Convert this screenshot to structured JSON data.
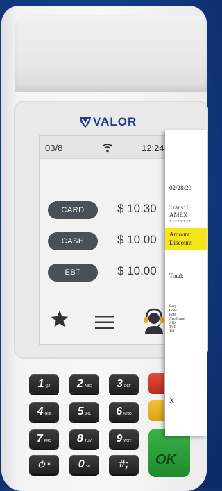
{
  "brand": {
    "name": "VALOR"
  },
  "status_bar": {
    "date": "03/8",
    "time": "12:24"
  },
  "payments": [
    {
      "label": "CARD",
      "amount": "$ 10.30"
    },
    {
      "label": "CASH",
      "amount": "$ 10.00"
    },
    {
      "label": "EBT",
      "amount": "$ 10.00"
    }
  ],
  "nav_icons": [
    "star-icon",
    "menu-icon",
    "support-agent-icon"
  ],
  "keypad": [
    {
      "num": "1",
      "sub": "QZ"
    },
    {
      "num": "2",
      "sub": "ABC"
    },
    {
      "num": "3",
      "sub": "DEF"
    },
    {
      "num": "4",
      "sub": "GHI"
    },
    {
      "num": "5",
      "sub": "JKL"
    },
    {
      "num": "6",
      "sub": "MNO"
    },
    {
      "num": "7",
      "sub": "PRS"
    },
    {
      "num": "8",
      "sub": "TUV"
    },
    {
      "num": "9",
      "sub": "WXY"
    },
    {
      "num": "⏻ *",
      "sub": ""
    },
    {
      "num": "0",
      "sub": "SP"
    },
    {
      "num": "#;",
      "sub": ""
    }
  ],
  "function_keys": {
    "ok_label": "OK"
  },
  "receipt": {
    "date": "02/28/20",
    "trans": "Trans: 6",
    "card": "AMEX",
    "masked": "********",
    "amount_label": "Amount:",
    "discount_label": "Discount",
    "total_label": "Total:",
    "details": [
      "Resp",
      "Code",
      "Ref#",
      "App Name",
      "AID",
      "TVR",
      "TSI"
    ],
    "signature_mark": "X"
  },
  "colors": {
    "background": "#123a82",
    "brand": "#1e3d8f",
    "pill": "#4a5056",
    "cancel": "#e64a3a",
    "clear": "#f2c238",
    "ok": "#3bb34a",
    "highlight": "#f5e61a"
  }
}
